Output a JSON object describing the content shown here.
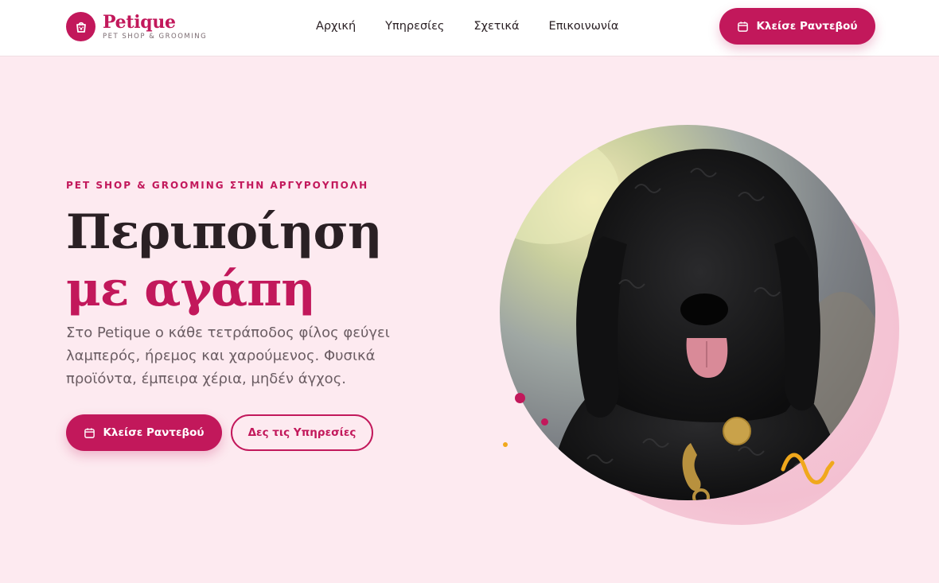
{
  "brand": {
    "name": "Petique",
    "tagline": "PET SHOP & GROOMING",
    "logo_icon": "paw-bag-icon"
  },
  "nav": {
    "items": [
      {
        "label": "Αρχική"
      },
      {
        "label": "Υπηρεσίες"
      },
      {
        "label": "Σχετικά"
      },
      {
        "label": "Επικοινωνία"
      }
    ],
    "cta_label": "Κλείσε Ραντεβού",
    "cta_icon": "calendar-icon"
  },
  "hero": {
    "eyebrow": "PET SHOP & GROOMING ΣΤΗΝ ΑΡΓΥΡΟΥΠΟΛΗ",
    "title_line1": "Περιποίηση",
    "title_line2": "με αγάπη",
    "description": "Στο Petique ο κάθε τετράποδος φίλος φεύγει λαμπερός, ήρεμος και χαρούμενος. Φυσικά προϊόντα, έμπειρα χέρια, μηδέν άγχος.",
    "primary_button": "Κλείσε Ραντεβού",
    "secondary_button": "Δες τις Υπηρεσίες"
  },
  "colors": {
    "accent": "#c2185b",
    "background": "#fdeaf0",
    "text_dark": "#2a2024",
    "yellow": "#f0a81c"
  }
}
